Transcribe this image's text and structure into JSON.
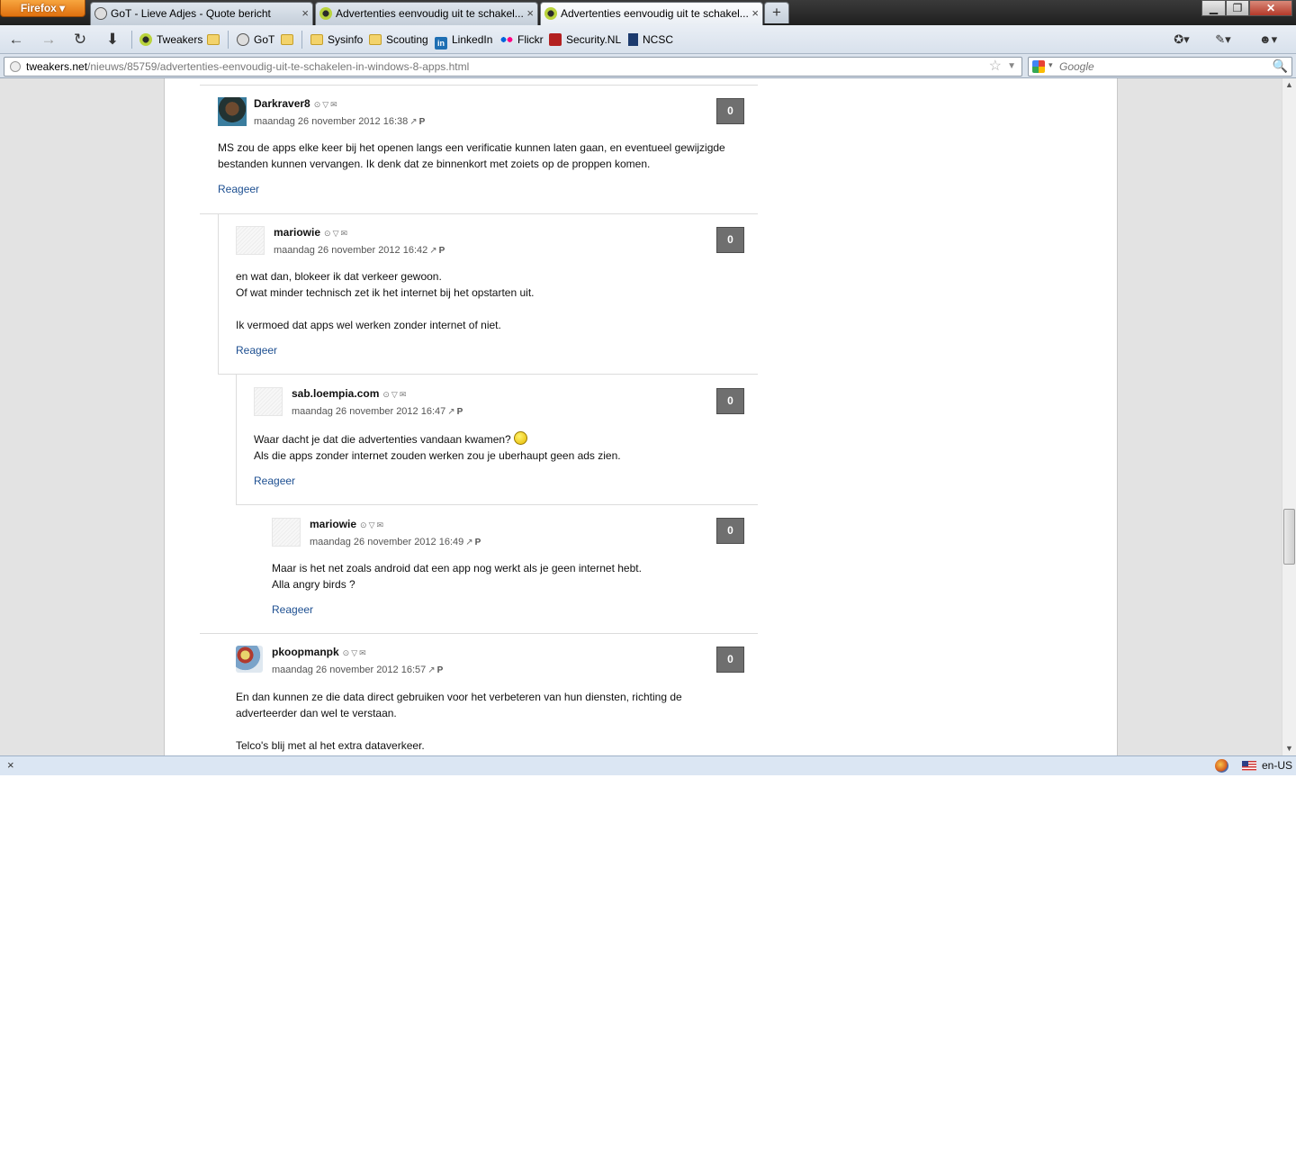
{
  "browser": {
    "app_button": "Firefox",
    "tabs": [
      {
        "label": "GoT - Lieve Adjes - Quote bericht",
        "active": false
      },
      {
        "label": "Advertenties eenvoudig uit te schakel...",
        "active": false
      },
      {
        "label": "Advertenties eenvoudig uit te schakel...",
        "active": true
      }
    ],
    "new_tab": "+",
    "window_controls": {
      "minimize": "▁",
      "maximize": "❐",
      "close": "✕"
    }
  },
  "navbar": {
    "back": "←",
    "forward": "→",
    "reload": "↻",
    "downloads": "⬇",
    "bookmarks": [
      {
        "label": "Tweakers",
        "icon": "tweakers-icon"
      },
      {
        "label": "",
        "icon": "folder-icon"
      },
      {
        "label": "GoT",
        "icon": "got-icon"
      },
      {
        "label": "",
        "icon": "folder-icon"
      },
      {
        "label": "Sysinfo",
        "icon": "folder-icon"
      },
      {
        "label": "Scouting",
        "icon": "folder-icon"
      },
      {
        "label": "LinkedIn",
        "icon": "linkedin-icon"
      },
      {
        "label": "Flickr",
        "icon": "flickr-icon"
      },
      {
        "label": "Security.NL",
        "icon": "securitynl-icon"
      },
      {
        "label": "NCSC",
        "icon": "ncsc-icon"
      }
    ]
  },
  "urlbar": {
    "host": "tweakers.net",
    "path": "/nieuws/85759/advertenties-eenvoudig-uit-te-schakelen-in-windows-8-apps.html",
    "star": "☆",
    "drop": "▼"
  },
  "search": {
    "placeholder": "Google",
    "go": "🔍"
  },
  "comments": [
    {
      "user": "Darkraver8",
      "tools": "⊙▽✉",
      "date": "maandag 26 november 2012 16:38",
      "perm": "↗",
      "p": "P",
      "score": "0",
      "lines": [
        "MS zou de apps elke keer bij het openen langs een verificatie kunnen laten gaan, en eventueel gewijzigde",
        "bestanden kunnen vervangen. Ik denk dat ze binnenkort met zoiets op de proppen komen."
      ],
      "reply": "Reageer"
    },
    {
      "user": "mariowie",
      "tools": "⊙▽✉",
      "date": "maandag 26 november 2012 16:42",
      "perm": "↗",
      "p": "P",
      "score": "0",
      "lines": [
        "en wat dan, blokeer ik dat verkeer gewoon.",
        "Of wat minder technisch zet ik het internet bij het opstarten uit.",
        "",
        "Ik vermoed dat apps wel werken zonder internet of niet."
      ],
      "reply": "Reageer"
    },
    {
      "user": "sab.loempia.com",
      "tools": "⊙▽✉",
      "date": "maandag 26 november 2012 16:47",
      "perm": "↗",
      "p": "P",
      "score": "0",
      "lines": [
        "Waar dacht je dat die advertenties vandaan kwamen?",
        "Als die apps zonder internet zouden werken zou je uberhaupt geen ads zien."
      ],
      "reply": "Reageer"
    },
    {
      "user": "mariowie",
      "tools": "⊙▽✉",
      "date": "maandag 26 november 2012 16:49",
      "perm": "↗",
      "p": "P",
      "score": "0",
      "lines": [
        "Maar is het net zoals android dat een app nog werkt als je geen internet hebt.",
        "Alla angry birds ?"
      ],
      "reply": "Reageer"
    },
    {
      "user": "pkoopmanpk",
      "tools": "⊙▽✉",
      "date": "maandag 26 november 2012 16:57",
      "perm": "↗",
      "p": "P",
      "score": "0",
      "lines": [
        "En dan kunnen ze die data direct gebruiken voor het verbeteren van hun diensten, richting de",
        "adverteerder dan wel te verstaan.",
        "",
        "Telco's blij met al het extra dataverkeer."
      ]
    }
  ],
  "statusbar": {
    "close": "×",
    "lang": "en-US"
  }
}
